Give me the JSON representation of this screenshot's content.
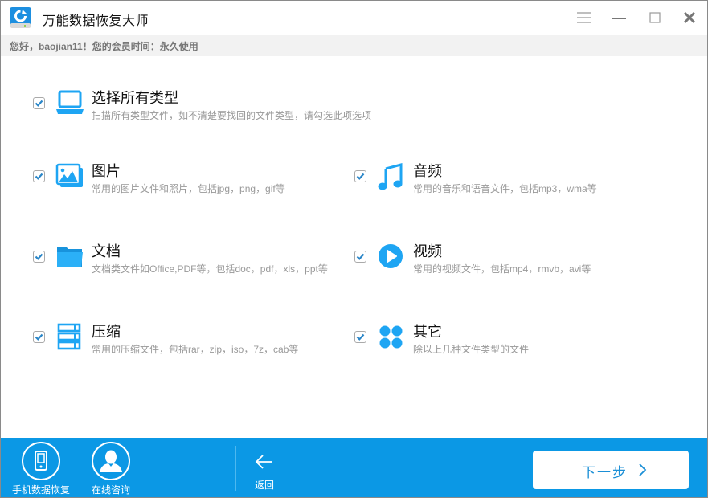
{
  "app": {
    "title": "万能数据恢复大师",
    "logo_icon": "refresh-disk-icon",
    "window_controls": [
      "menu-icon",
      "minimize-icon",
      "maximize-icon",
      "close-icon"
    ]
  },
  "infobar": {
    "text": "您好，baojian11！您的会员时间：永久使用"
  },
  "options": {
    "all": {
      "title": "选择所有类型",
      "desc": "扫描所有类型文件，如不清楚要找回的文件类型，请勾选此项选项",
      "checked": true,
      "icon": "laptop-icon"
    },
    "pictures": {
      "title": "图片",
      "desc": "常用的图片文件和照片，包括jpg，png，gif等",
      "checked": true,
      "icon": "image-icon"
    },
    "audio": {
      "title": "音频",
      "desc": "常用的音乐和语音文件，包括mp3，wma等",
      "checked": true,
      "icon": "music-note-icon"
    },
    "documents": {
      "title": "文档",
      "desc": "文档类文件如Office,PDF等，包括doc，pdf，xls，ppt等",
      "checked": true,
      "icon": "folder-icon"
    },
    "video": {
      "title": "视频",
      "desc": "常用的视频文件，包括mp4，rmvb，avi等",
      "checked": true,
      "icon": "play-icon"
    },
    "archives": {
      "title": "压缩",
      "desc": "常用的压缩文件，包括rar，zip，iso，7z，cab等",
      "checked": true,
      "icon": "archive-stack-icon"
    },
    "others": {
      "title": "其它",
      "desc": "除以上几种文件类型的文件",
      "checked": true,
      "icon": "grid-dots-icon"
    }
  },
  "footer": {
    "phone_recovery_label": "手机数据恢复",
    "online_consult_label": "在线咨询",
    "back_label": "返回",
    "next_label": "下一步"
  },
  "colors": {
    "accent": "#0b98e5",
    "icon_blue": "#1ea5f3",
    "check_blue": "#2a86c8",
    "next_text": "#1b8fd6"
  }
}
